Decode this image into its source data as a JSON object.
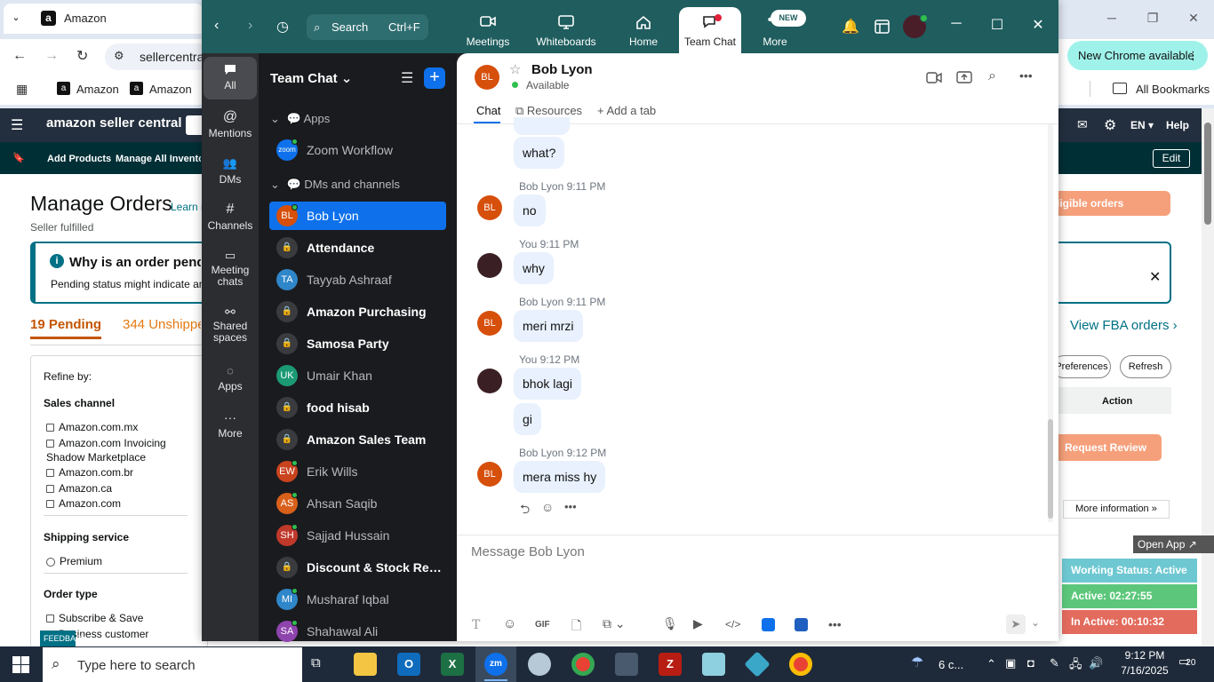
{
  "chrome": {
    "tab_title": "Amazon",
    "address": "sellercentra",
    "new_chrome": "New Chrome available",
    "bookmarks": [
      "Amazon",
      "Amazon"
    ],
    "all_bookmarks": "All Bookmarks"
  },
  "amazon": {
    "logo": "amazon seller central",
    "nav_right": [
      "EN",
      "Help"
    ],
    "sub_links": [
      "Add Products",
      "Manage All Inventory"
    ],
    "edit": "Edit",
    "title": "Manage Orders",
    "learn": "Learn m",
    "seller_fulfilled": "Seller fulfilled",
    "info_title": "Why is an order pendi",
    "info_body": "Pending status might indicate an",
    "tab_pending": "19 Pending",
    "tab_unshipped": "344 Unshippe",
    "refine_by": "Refine by:",
    "sales_channel": "Sales channel",
    "channels": [
      "Amazon.com.mx",
      "Amazon.com Invoicing Shadow Marketplace",
      "Amazon.com.br",
      "Amazon.ca",
      "Amazon.com"
    ],
    "shipping_service": "Shipping service",
    "shipping_options": [
      "Premium"
    ],
    "order_type": "Order type",
    "order_types": [
      "Subscribe & Save",
      "Business customer"
    ],
    "eligible": "ligible orders available",
    "view_fba": "View FBA orders ›",
    "preferences": "Preferences",
    "refresh": "Refresh",
    "action": "Action",
    "request_review": "Request Review",
    "more_info": "More information »",
    "open_app": "Open App ↗",
    "working_status": "Working Status: Active",
    "active": "Active: 02:27:55",
    "inactive": "In Active: 00:10:32",
    "feedback": "FEEDBACK ✕"
  },
  "zoom": {
    "search": "Search",
    "search_shortcut": "Ctrl+F",
    "tabs": [
      {
        "label": "Meetings",
        "icon": "video-camera-icon"
      },
      {
        "label": "Whiteboards",
        "icon": "whiteboard-icon"
      },
      {
        "label": "Home",
        "icon": "home-icon"
      },
      {
        "label": "Team Chat",
        "icon": "chat-icon"
      },
      {
        "label": "More",
        "icon": "more-icon"
      }
    ],
    "new_badge": "NEW",
    "left_nav": [
      "All",
      "Mentions",
      "DMs",
      "Channels",
      "Meeting chats",
      "Shared spaces",
      "Apps",
      "More"
    ],
    "list_title": "Team Chat",
    "apps_section": "Apps",
    "dms_section": "DMs and channels",
    "apps": [
      {
        "name": "Zoom Workflow",
        "initials": "zoom"
      }
    ],
    "channels": [
      {
        "name": "Bob Lyon",
        "initials": "BL",
        "color": "#d64f0b",
        "selected": true,
        "online": true
      },
      {
        "name": "Attendance",
        "locked": true,
        "bold": true
      },
      {
        "name": "Tayyab Ashraaf",
        "initials": "TA",
        "color": "#2f86c9"
      },
      {
        "name": "Amazon Purchasing",
        "locked": true,
        "bold": true
      },
      {
        "name": "Samosa Party",
        "locked": true,
        "bold": true
      },
      {
        "name": "Umair Khan",
        "initials": "UK",
        "color": "#1b9a73"
      },
      {
        "name": "food hisab",
        "locked": true,
        "bold": true
      },
      {
        "name": "Amazon Sales Team",
        "locked": true,
        "bold": true
      },
      {
        "name": "Erik Wills",
        "initials": "EW",
        "color": "#c9431e",
        "online": true
      },
      {
        "name": "Ahsan Saqib",
        "initials": "AS",
        "color": "#d9601a",
        "online": true
      },
      {
        "name": "Sajjad Hussain",
        "initials": "SH",
        "color": "#c0392b",
        "online": true
      },
      {
        "name": "Discount & Stock Res...",
        "locked": true,
        "bold": true
      },
      {
        "name": "Musharaf Iqbal",
        "initials": "MI",
        "color": "#2f86c9",
        "online": true
      },
      {
        "name": "Shahawal Ali",
        "initials": "SA",
        "color": "#8e44ad",
        "online": true
      }
    ],
    "chat": {
      "contact": "Bob Lyon",
      "initials": "BL",
      "status": "Available",
      "tab_chat": "Chat",
      "tab_resources": "Resources",
      "add_tab": "Add a tab",
      "messages": [
        {
          "sender": "",
          "time": "",
          "texts": [
            "what?"
          ],
          "me": true
        },
        {
          "sender": "Bob Lyon",
          "time": "9:11 PM",
          "texts": [
            "no"
          ],
          "me": false
        },
        {
          "sender": "You",
          "time": "9:11 PM",
          "texts": [
            "why"
          ],
          "me": true
        },
        {
          "sender": "Bob Lyon",
          "time": "9:11 PM",
          "texts": [
            "meri mrzi"
          ],
          "me": false
        },
        {
          "sender": "You",
          "time": "9:12 PM",
          "texts": [
            "bhok lagi",
            "gi"
          ],
          "me": true
        },
        {
          "sender": "Bob Lyon",
          "time": "9:12 PM",
          "texts": [
            "mera miss hy"
          ],
          "me": false
        }
      ],
      "placeholder": "Message Bob Lyon"
    }
  },
  "taskbar": {
    "search": "Type here to search",
    "weather": "6 c...",
    "time": "9:12 PM",
    "date": "7/16/2025",
    "notifications": "20"
  }
}
